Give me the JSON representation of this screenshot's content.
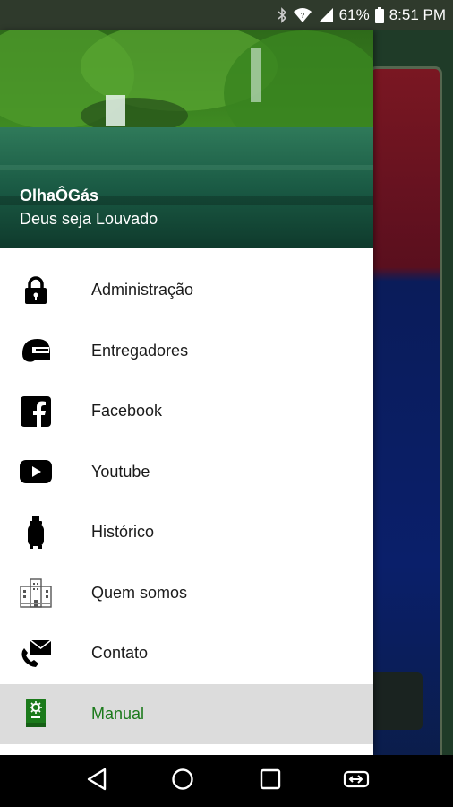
{
  "status_bar": {
    "battery_percent": "61%",
    "time": "8:51 PM",
    "icons": [
      "bluetooth-icon",
      "wifi-icon",
      "signal-icon",
      "battery-icon"
    ]
  },
  "drawer": {
    "header": {
      "title": "OlhaÔGás",
      "subtitle": "Deus seja Louvado"
    },
    "items": [
      {
        "label": "Administração",
        "icon": "lock-icon"
      },
      {
        "label": "Entregadores",
        "icon": "helmet-icon"
      },
      {
        "label": "Facebook",
        "icon": "facebook-icon"
      },
      {
        "label": "Youtube",
        "icon": "youtube-icon"
      },
      {
        "label": "Histórico",
        "icon": "gas-cylinder-icon"
      },
      {
        "label": "Quem somos",
        "icon": "building-icon"
      },
      {
        "label": "Contato",
        "icon": "contact-icon"
      },
      {
        "label": "Manual",
        "icon": "manual-icon"
      }
    ],
    "selected_index": 7
  },
  "colors": {
    "selected_text": "#1b7a1b",
    "selected_background": "#dcdcdc",
    "status_bar": "#2f3a2c"
  },
  "nav_bar": {
    "buttons": [
      "back-icon",
      "home-icon",
      "recents-icon",
      "switch-apps-icon"
    ]
  }
}
